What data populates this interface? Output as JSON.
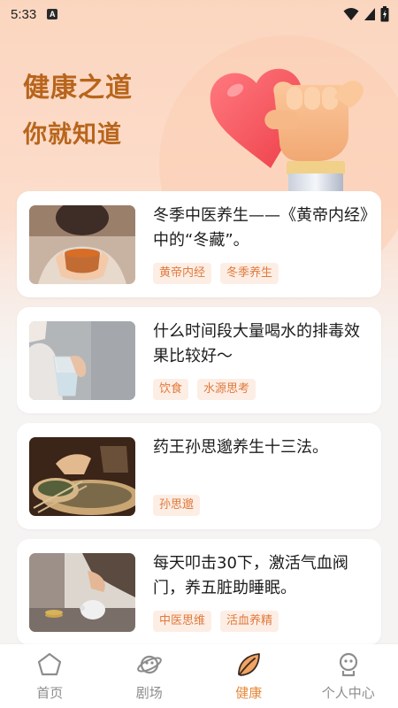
{
  "status_bar": {
    "time": "5:33",
    "notification_icon": "a-icon",
    "icons": [
      "wifi-icon",
      "cell-signal-icon",
      "battery-icon"
    ]
  },
  "hero": {
    "title": "健康之道",
    "subtitle": "你就知道",
    "illustration": "heart-hand-icon",
    "title_color": "#b8651c"
  },
  "articles": [
    {
      "title": "冬季中医养生——《黄帝内经》中的“冬藏”。",
      "tags": [
        "黄帝内经",
        "冬季养生"
      ],
      "thumbnail": "tea-cup-image"
    },
    {
      "title": "什么时间段大量喝水的排毒效果比较好～",
      "tags": [
        "饮食",
        "水源思考"
      ],
      "thumbnail": "water-glass-image"
    },
    {
      "title": "药王孙思邈养生十三法。",
      "tags": [
        "孙思邈"
      ],
      "thumbnail": "herbs-image"
    },
    {
      "title": "每天叩击30下，激活气血阀门，养五脏助睡眠。",
      "tags": [
        "中医思维",
        "活血养精"
      ],
      "thumbnail": "piggy-bank-image"
    }
  ],
  "tab_bar": {
    "active_tab": "健康",
    "accent_color": "#e58a3c",
    "tabs": [
      {
        "label": "首页",
        "icon": "home-icon"
      },
      {
        "label": "剧场",
        "icon": "planet-icon"
      },
      {
        "label": "健康",
        "icon": "leaf-icon"
      },
      {
        "label": "个人中心",
        "icon": "profile-icon"
      }
    ]
  }
}
